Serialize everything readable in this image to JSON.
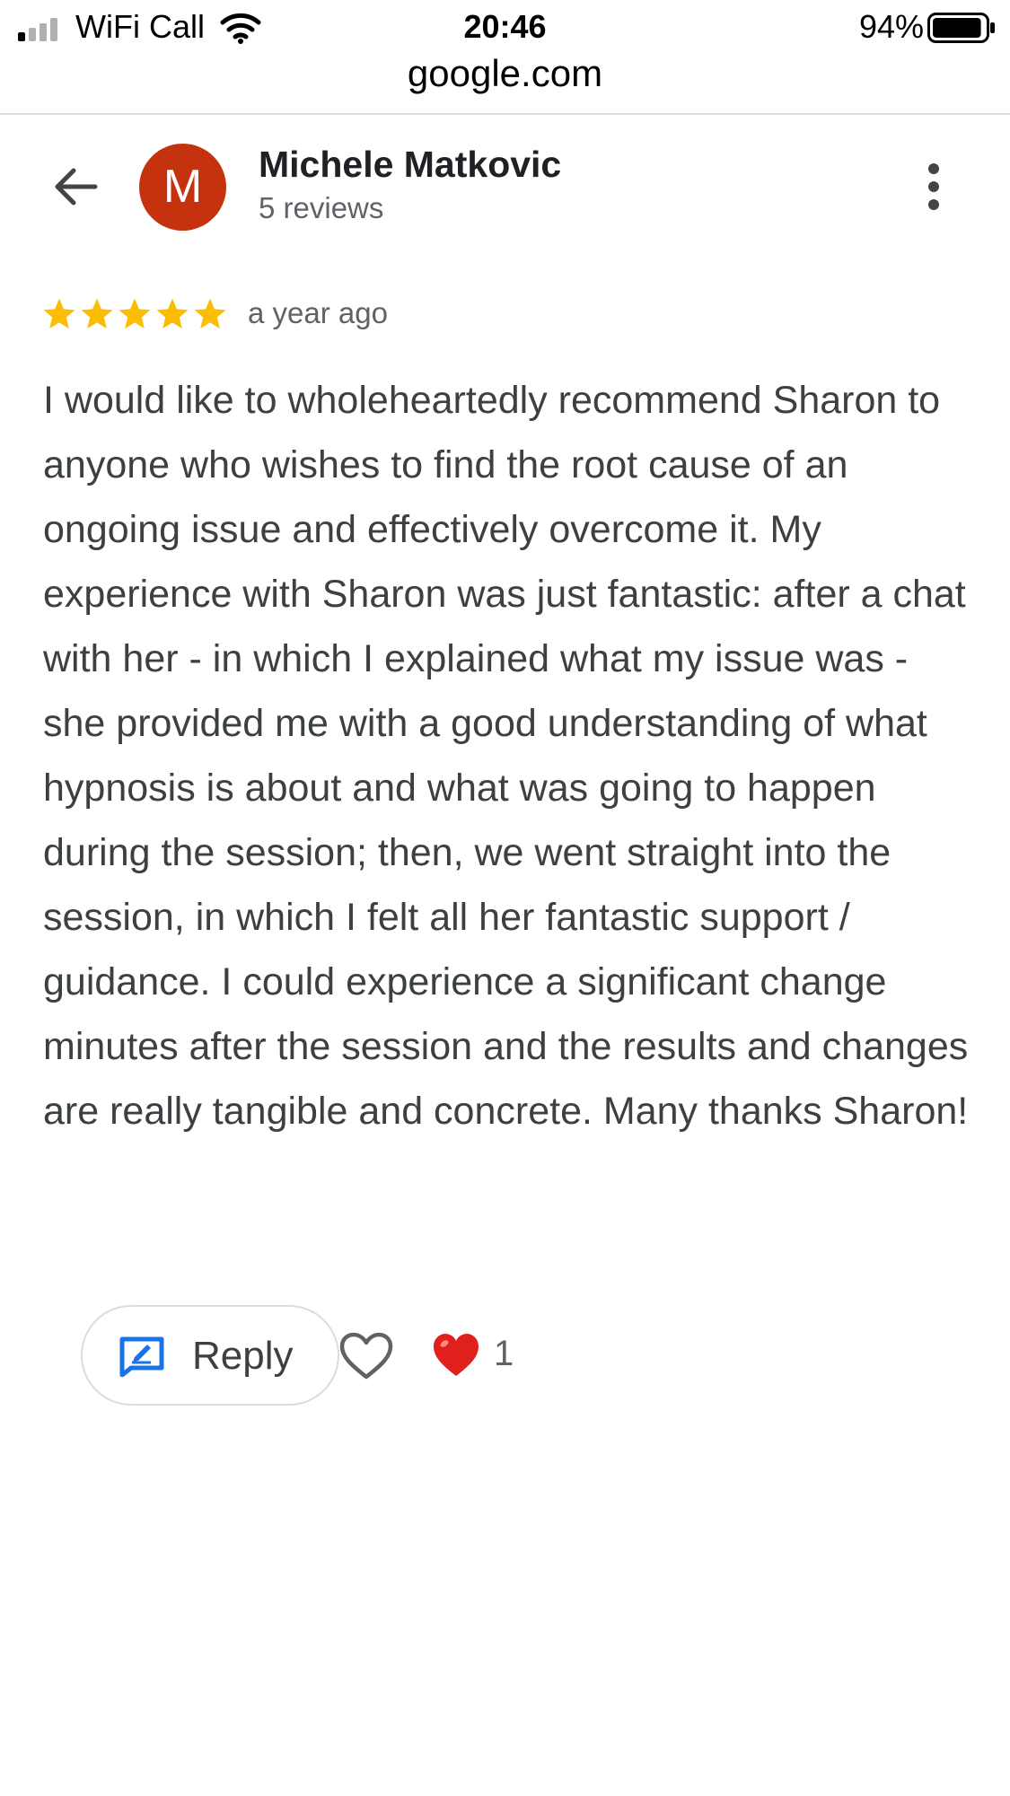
{
  "status_bar": {
    "carrier": "WiFi Call",
    "time": "20:46",
    "battery": "94%",
    "battery_level": 0.94
  },
  "browser": {
    "domain": "google.com"
  },
  "reviewer": {
    "initial": "M",
    "name": "Michele Matkovic",
    "review_count": "5 reviews",
    "avatar_color": "#c5330e"
  },
  "review": {
    "rating": 5,
    "star_color": "#fbbc04",
    "date": "a year ago",
    "text": "I would like to wholeheartedly recommend Sharon to anyone who wishes to find the root cause of an ongoing issue and effectively overcome it. My experience with Sharon was just fantastic: after a chat with her - in which I explained what my issue was - she provided me with a good understanding of what hypnosis is about and what was going to happen during the session; then, we went straight into the session, in which I felt all her fantastic support / guidance. I could experience a significant change minutes after the session and the results and changes are really tangible and concrete. Many thanks Sharon!"
  },
  "actions": {
    "reply_label": "Reply",
    "reaction_count": "1",
    "icons": {
      "reply": "reply-icon",
      "like": "heart-outline-icon",
      "reaction": "red-heart-icon"
    }
  }
}
